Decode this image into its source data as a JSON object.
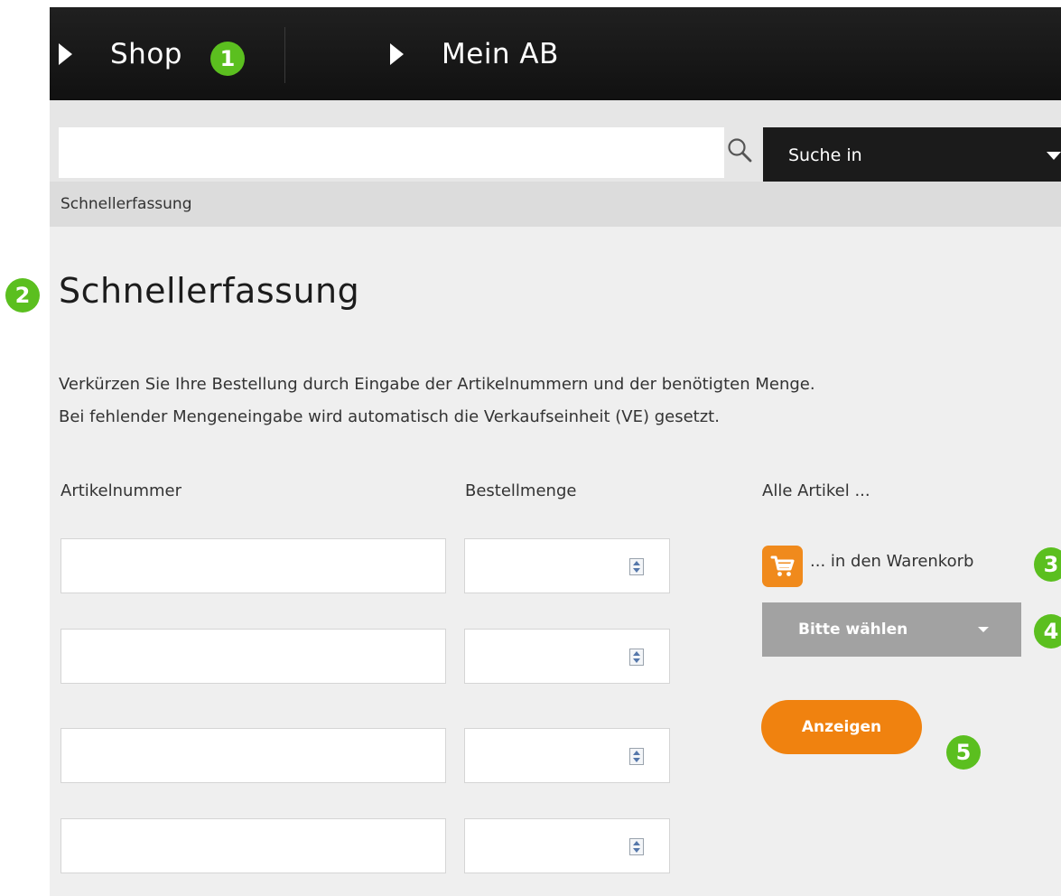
{
  "nav": {
    "items": [
      {
        "label": "Shop"
      },
      {
        "label": "Mein AB"
      }
    ]
  },
  "markers": [
    "1",
    "2",
    "3",
    "4",
    "5"
  ],
  "search": {
    "value": "",
    "placeholder": "",
    "scope_label": "Suche in"
  },
  "breadcrumb": "Schnellerfassung",
  "page": {
    "title": "Schnellerfassung",
    "intro_lines": [
      "Verkürzen Sie Ihre Bestellung durch Eingabe der Artikelnummern und der benötigten Menge.",
      "Bei fehlender Mengeneingabe wird automatisch die Verkaufseinheit (VE) gesetzt."
    ]
  },
  "columns": {
    "article": "Artikelnummer",
    "quantity": "Bestellmenge",
    "all_items": "Alle Artikel ..."
  },
  "rows": [
    {
      "article": "",
      "quantity": ""
    },
    {
      "article": "",
      "quantity": ""
    },
    {
      "article": "",
      "quantity": ""
    },
    {
      "article": "",
      "quantity": ""
    }
  ],
  "actions": {
    "cart_label": "... in den Warenkorb",
    "select_label": "Bitte wählen",
    "show_label": "Anzeigen"
  },
  "icons": {
    "nav_arrow": "play-arrow-icon",
    "search": "search-icon",
    "cart": "shopping-cart-icon",
    "dropdown": "chevron-down-icon"
  },
  "colors": {
    "accent_orange": "#f0820f",
    "marker_green": "#5bbf1f",
    "nav_background": "#161616",
    "select_gray": "#a2a2a2"
  }
}
